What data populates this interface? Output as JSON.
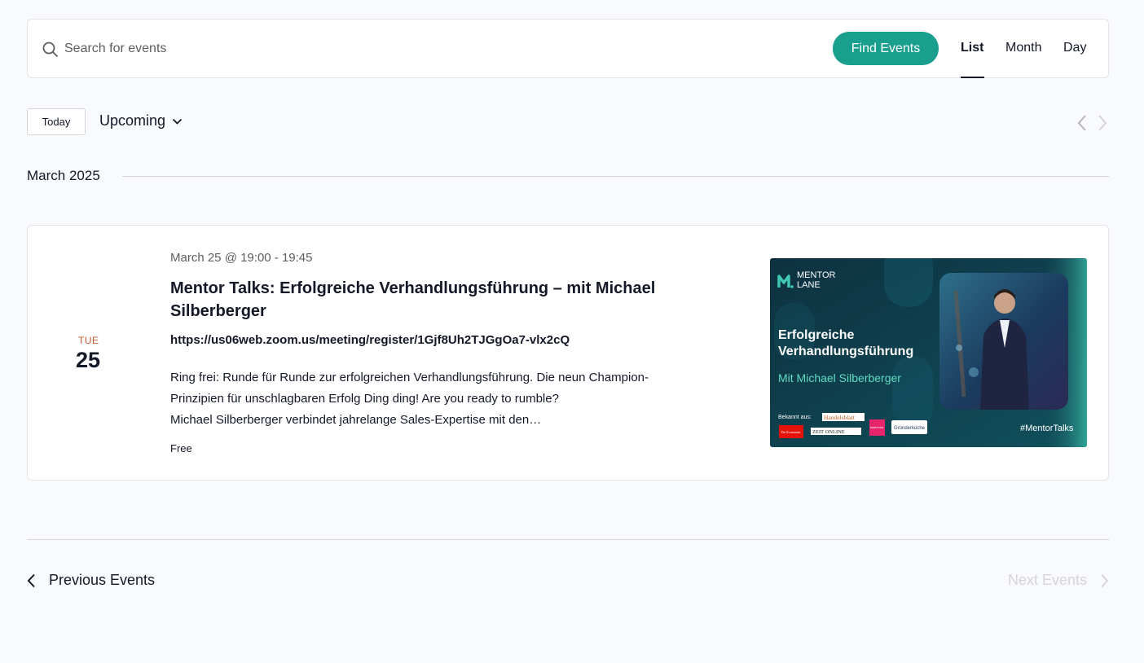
{
  "search": {
    "placeholder": "Search for events",
    "value": "",
    "find_label": "Find Events"
  },
  "views": [
    {
      "label": "List",
      "active": true
    },
    {
      "label": "Month",
      "active": false
    },
    {
      "label": "Day",
      "active": false
    }
  ],
  "toolbar": {
    "today_label": "Today",
    "range_label": "Upcoming"
  },
  "month_separator": "March 2025",
  "event": {
    "day_of_week": "TUE",
    "day": "25",
    "datetime": "March 25 @ 19:00 - 19:45",
    "title": "Mentor Talks: Erfolgreiche Verhandlungsführung – mit Michael Silberberger",
    "link": "https://us06web.zoom.us/meeting/register/1Gjf8Uh2TJGgOa7-vlx2cQ",
    "description_lines": [
      "Ring frei: Runde für Runde zur erfolgreichen Verhandlungsführung. Die neun Champion-",
      "Prinzipien für unschlagbaren Erfolg Ding ding! Are you ready to rumble?",
      "Michael Silberberger verbindet jahrelange Sales-Expertise mit den…"
    ],
    "price": "Free",
    "image": {
      "brand_line1": "MENTOR",
      "brand_line2": "LANE",
      "headline_line1": "Erfolgreiche",
      "headline_line2": "Verhandlungsführung",
      "subline": "Mit Michael Silberberger",
      "known_from": "Bekannt aus:",
      "press_logos": [
        "Handelsblatt",
        "The Economist",
        "ZEIT ONLINE",
        "brand eins",
        "Gründerküche"
      ],
      "hashtag": "#MentorTalks"
    }
  },
  "pagination": {
    "previous_label": "Previous Events",
    "next_label": "Next Events"
  },
  "colors": {
    "accent": "#1a9f8f",
    "day_of_week": "#c85a2f",
    "image_bg": "#0f3b4a",
    "image_accent": "#3fc9b1"
  }
}
